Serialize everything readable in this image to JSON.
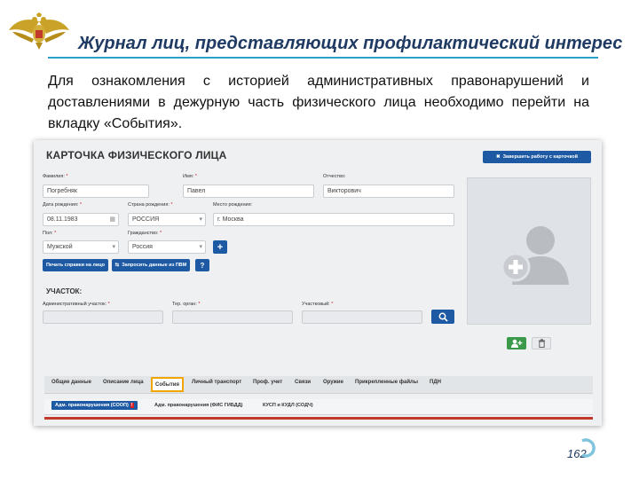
{
  "slide": {
    "title": "Журнал лиц, представляющих профилактический интерес",
    "intro": "Для ознакомления с историей административных правонарушений и доставлениями в дежурную часть  физического лица необходимо перейти на вкладку «События».",
    "page_number": "162"
  },
  "card": {
    "title": "КАРТОЧКА ФИЗИЧЕСКОГО ЛИЦА",
    "finish_button": "Завершить работу с карточкой",
    "fields": {
      "surname": {
        "label": "Фамилия:",
        "value": "Погребняк"
      },
      "name": {
        "label": "Имя:",
        "value": "Павел"
      },
      "patronymic": {
        "label": "Отчество:",
        "value": "Викторович"
      },
      "birth_date": {
        "label": "Дата рождения:",
        "value": "08.11.1983"
      },
      "birth_country": {
        "label": "Страна рождения:",
        "value": "РОССИЯ"
      },
      "birth_place": {
        "label": "Место рождения:",
        "value": "г. Москва"
      },
      "sex": {
        "label": "Пол:",
        "value": "Мужской"
      },
      "citizenship": {
        "label": "Гражданство:",
        "value": "Россия"
      }
    },
    "required_mark": "*",
    "print_button": "Печать справки на лицо",
    "request_button": "Запросить данные из ПВМ",
    "help_button": "?",
    "add_button": "+",
    "section_title": "УЧАСТОК:",
    "district_fields": {
      "admin": {
        "label": "Административный участок:",
        "value": ""
      },
      "territorial": {
        "label": "Тер. орган:",
        "value": ""
      },
      "district": {
        "label": "Участковый:",
        "value": ""
      }
    }
  },
  "tabs": [
    {
      "label": "Общие данные"
    },
    {
      "label": "Описание лица"
    },
    {
      "label": "События",
      "active": true
    },
    {
      "label": "Личный транспорт"
    },
    {
      "label": "Проф. учет"
    },
    {
      "label": "Связи"
    },
    {
      "label": "Оружие"
    },
    {
      "label": "Прикрепленные файлы"
    },
    {
      "label": "ПДН"
    }
  ],
  "subtabs": [
    {
      "label": "Адм. правонарушения (СООП)",
      "active": true,
      "badge": "!"
    },
    {
      "label": "Адм. правонарушения (ФИС ГИБДД)"
    },
    {
      "label": "КУСП и КУДЛ (СОДЧ)"
    }
  ],
  "colors": {
    "title": "#1f3b63",
    "rule": "#2aa0c8",
    "primary_button": "#1d5aa3",
    "active_tab_border": "#f0a500",
    "add_photo_button": "#3a9a4a"
  },
  "icons": [
    "eagle-emblem",
    "close-icon",
    "swap-icon",
    "search-icon",
    "add-user-icon",
    "trash-icon",
    "avatar-placeholder-icon"
  ]
}
